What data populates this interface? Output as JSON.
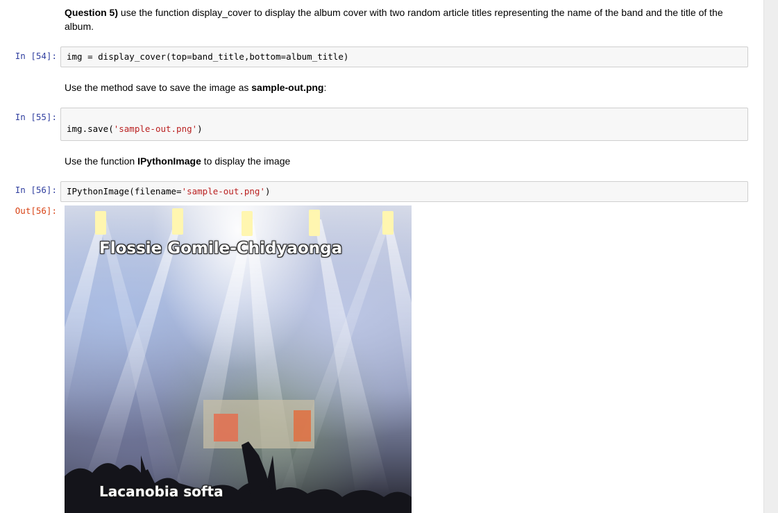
{
  "cells": {
    "q5": {
      "heading": "Question 5)",
      "text": " use the function display_cover to display the album cover with two random article titles representing the name of the band and the title of the album."
    },
    "c54": {
      "prompt": "In [54]:",
      "code": "img = display_cover(top=band_title,bottom=album_title)"
    },
    "md_save": {
      "pre": "Use the method save to save the image as ",
      "bold": "sample-out.png",
      "post": ":"
    },
    "c55": {
      "prompt": "In [55]:",
      "code_pre": "img.save(",
      "code_str": "'sample-out.png'",
      "code_post": ")"
    },
    "md_display": {
      "pre": "Use the function ",
      "bold": "IPythonImage",
      "post": " to display the image"
    },
    "c56": {
      "prompt": "In [56]:",
      "code_pre": "IPythonImage(filename=",
      "code_str": "'sample-out.png'",
      "code_post": ")",
      "out_prompt": "Out[56]:"
    }
  },
  "cover": {
    "top_title": "Flossie Gomile-Chidyaonga",
    "bottom_title": "Lacanobia softa"
  }
}
